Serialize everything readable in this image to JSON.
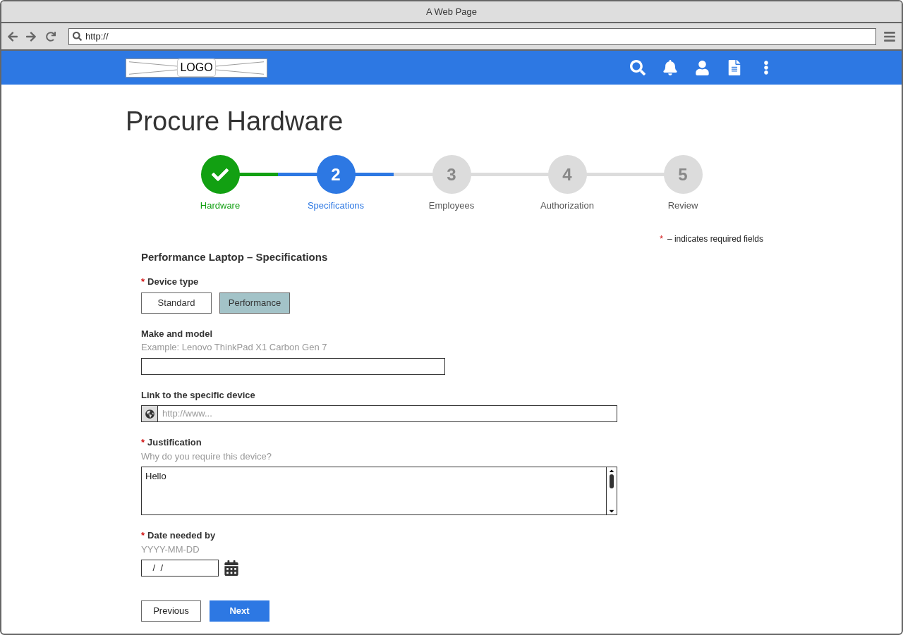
{
  "window": {
    "title": "A Web Page"
  },
  "address_bar": {
    "value": "http://"
  },
  "header": {
    "logo": "LOGO"
  },
  "page_title": "Procure Hardware",
  "steps": [
    {
      "label": "Hardware",
      "kind": "done"
    },
    {
      "label": "Specifications",
      "number": "2",
      "kind": "current"
    },
    {
      "label": "Employees",
      "number": "3",
      "kind": "todo"
    },
    {
      "label": "Authorization",
      "number": "4",
      "kind": "todo"
    },
    {
      "label": "Review",
      "number": "5",
      "kind": "todo"
    }
  ],
  "required_note": {
    "mark": "*",
    "text": "– indicates required fields"
  },
  "form": {
    "title": "Performance Laptop – Specifications",
    "fields": [
      {
        "kind": "toggle",
        "label": "Device type",
        "required": true,
        "options": [
          {
            "label": "Standard",
            "selected": false
          },
          {
            "label": "Performance",
            "selected": true
          }
        ]
      },
      {
        "kind": "text",
        "label": "Make and model",
        "required": false,
        "hint": "Example: Lenovo ThinkPad X1 Carbon Gen 7"
      },
      {
        "kind": "url",
        "label": "Link to the specific device",
        "required": false,
        "placeholder": "http://www..."
      },
      {
        "kind": "textarea",
        "label": "Justification",
        "required": true,
        "hint": "Why do you require this device?",
        "value": "Hello"
      },
      {
        "kind": "date",
        "label": "Date needed by",
        "required": true,
        "hint": "YYYY-MM-DD",
        "value": " /  /"
      }
    ]
  },
  "buttons": [
    {
      "label": "Previous",
      "kind": "secondary"
    },
    {
      "label": "Next",
      "kind": "primary"
    }
  ]
}
